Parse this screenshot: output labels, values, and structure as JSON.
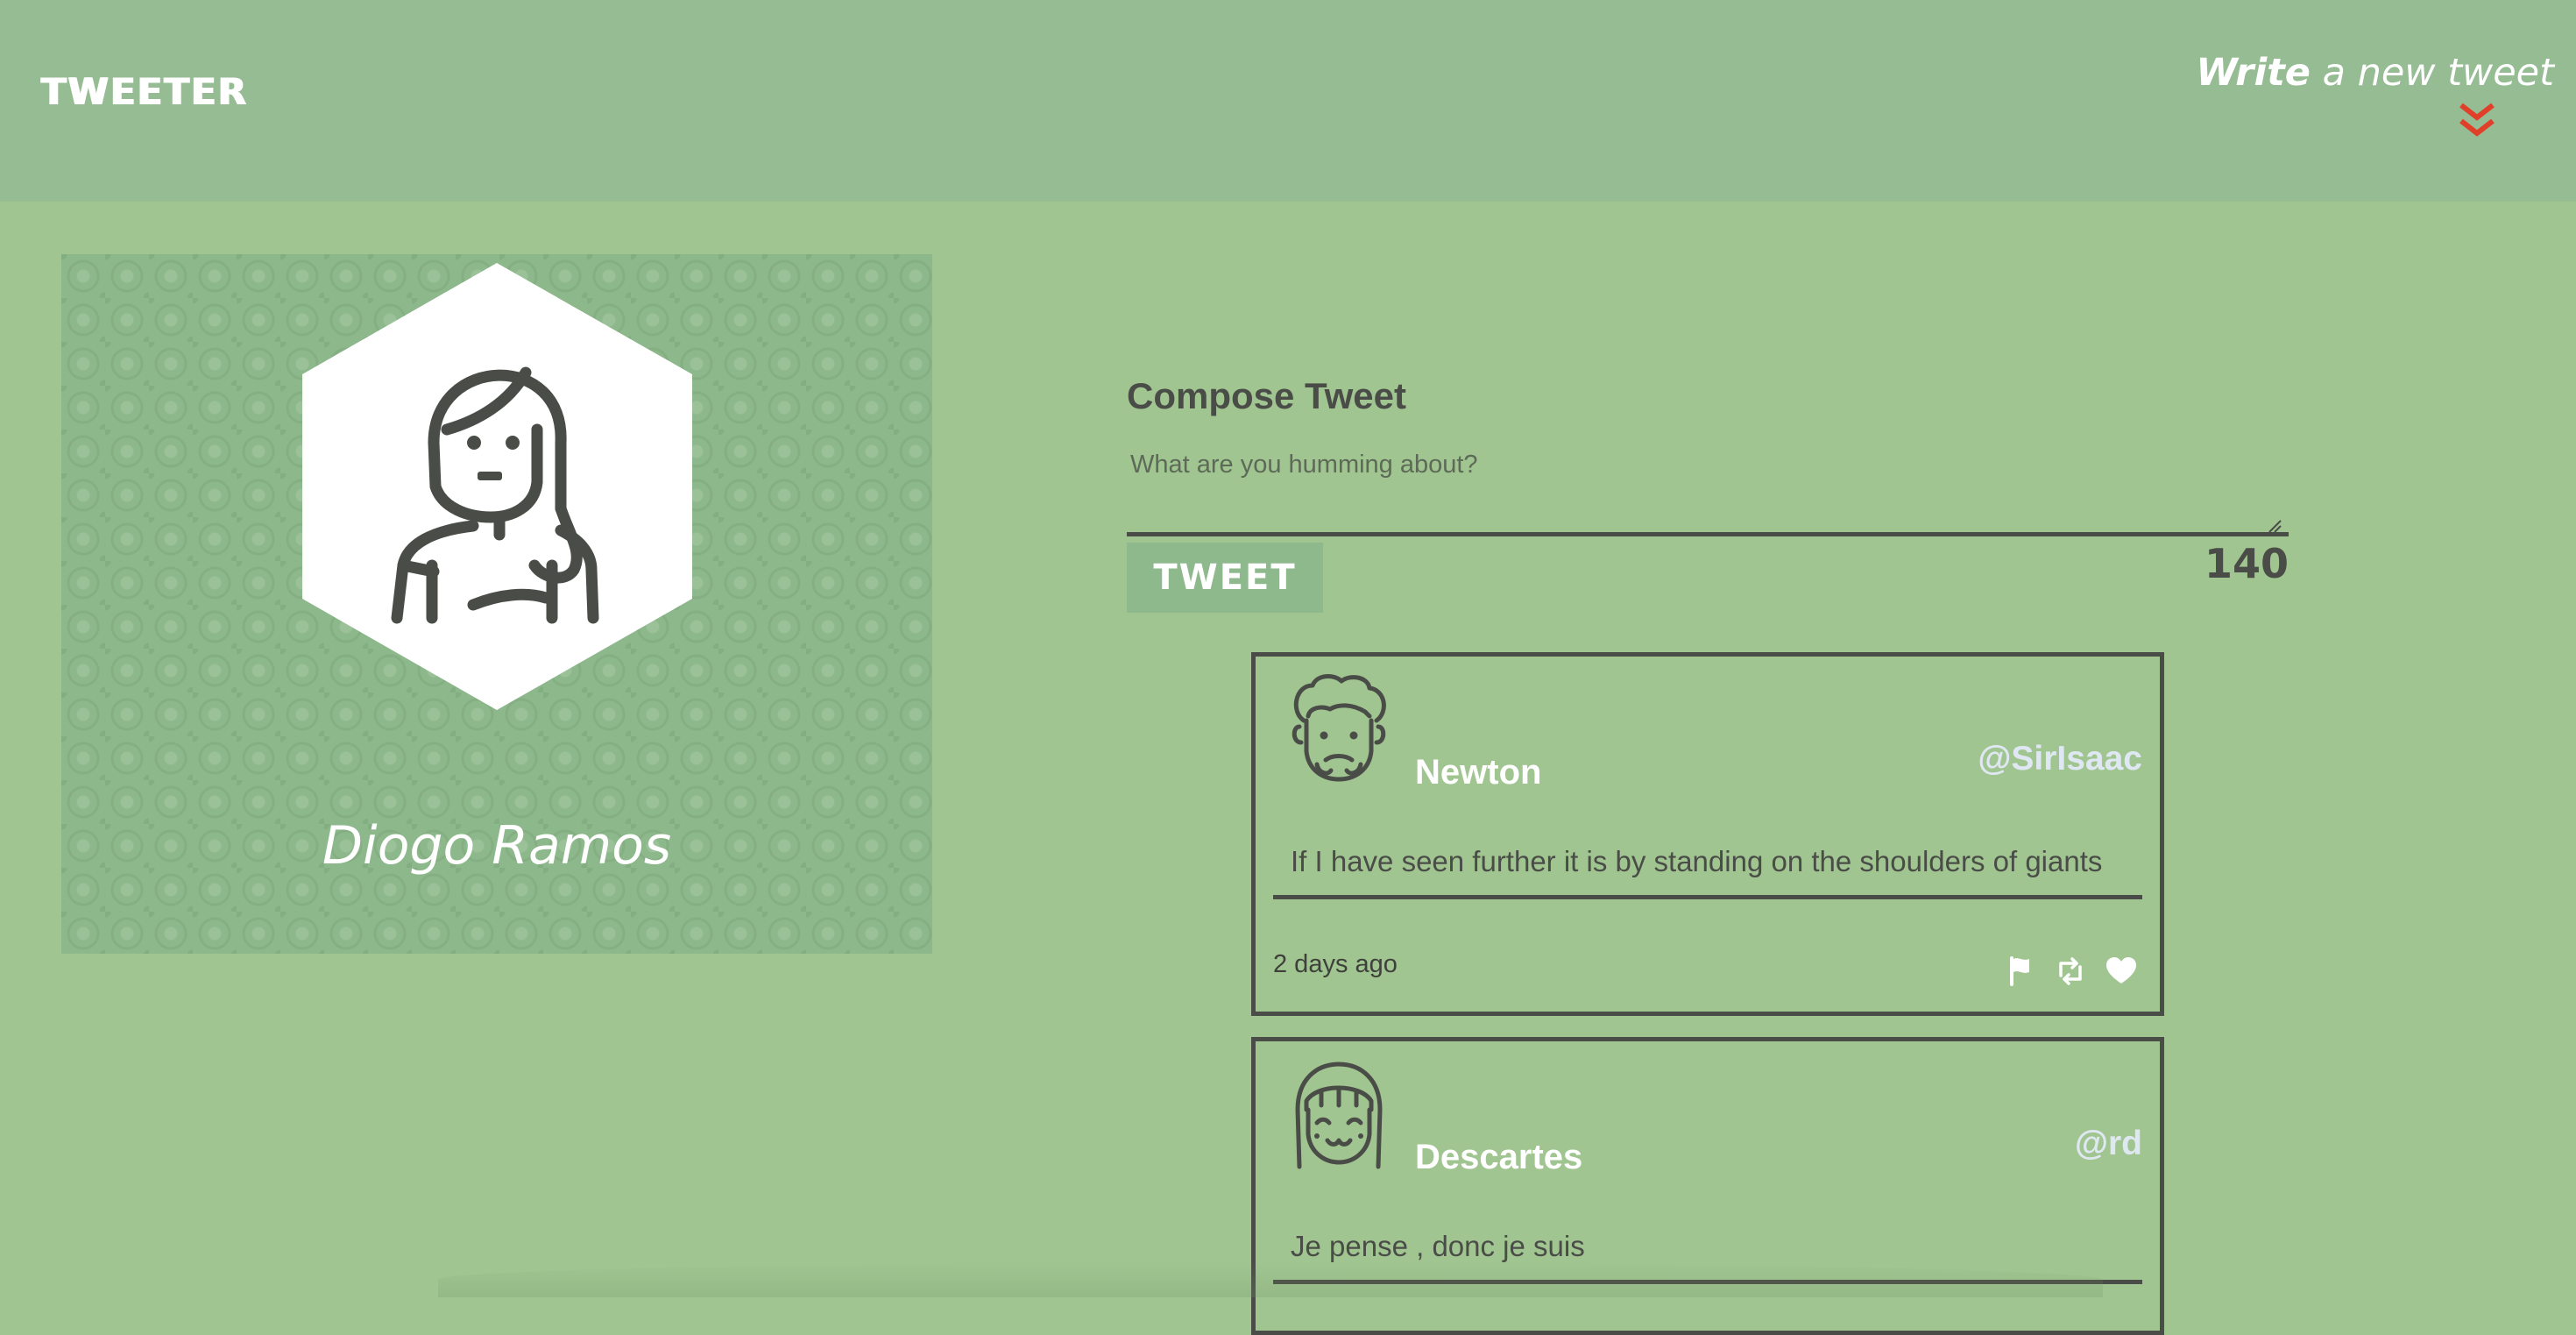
{
  "nav": {
    "brand": "TWEETER",
    "compose_toggle_bold": "Write",
    "compose_toggle_rest": " a new tweet",
    "toggle_icon": "double-chevron-down-icon",
    "accent_color": "#e0402a"
  },
  "profile": {
    "name": "Diogo Ramos",
    "avatar_icon": "user-avatar-icon"
  },
  "compose": {
    "title": "Compose Tweet",
    "placeholder": "What are you humming about?",
    "button_label": "TWEET",
    "counter": "140"
  },
  "tweets": [
    {
      "name": "Newton",
      "handle": "@SirIsaac",
      "content": "If I have seen further it is by standing on the shoulders of giants",
      "time": "2 days ago",
      "actions": [
        "flag-icon",
        "retweet-icon",
        "heart-icon"
      ]
    },
    {
      "name": "Descartes",
      "handle": "@rd",
      "content": "Je pense , donc je suis"
    }
  ],
  "colors": {
    "background": "#a1c591",
    "header": "#96bc93",
    "ink": "#4a4d47",
    "handle": "#dfe8f2"
  }
}
